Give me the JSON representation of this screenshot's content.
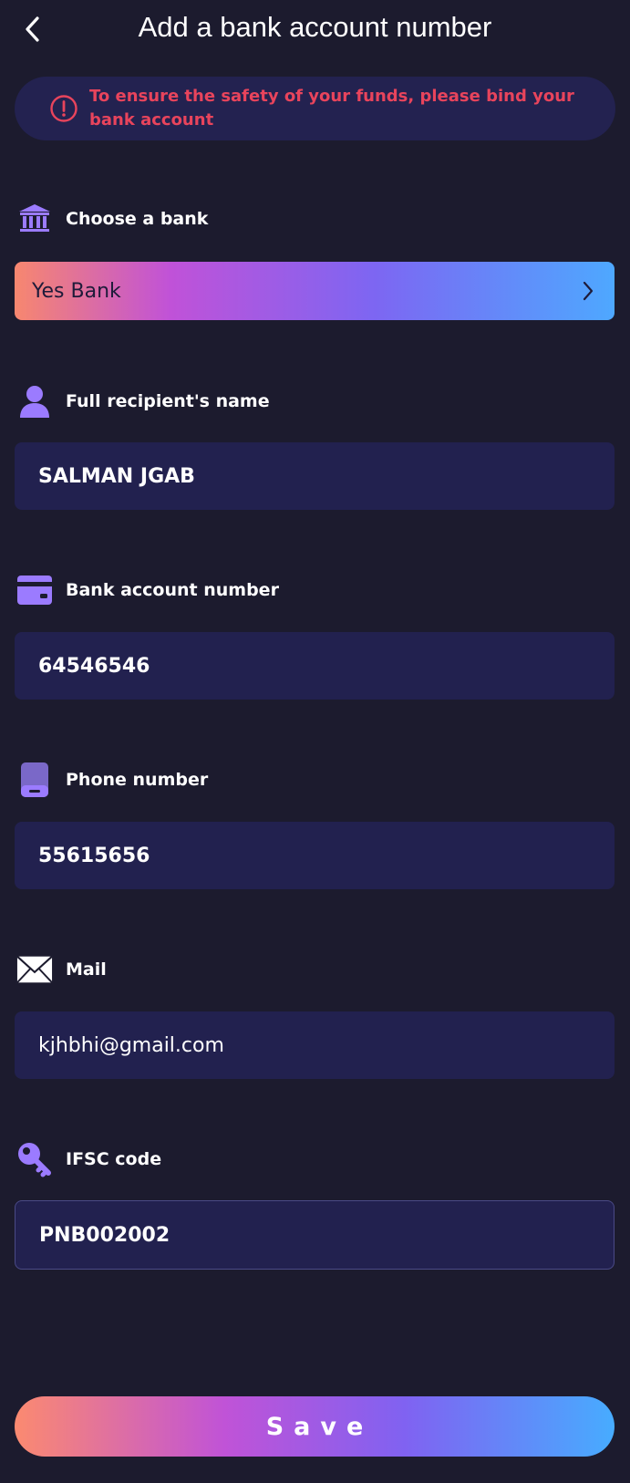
{
  "header": {
    "title": "Add a bank account number"
  },
  "notice": {
    "text": "To ensure the safety of your funds, please bind your bank account"
  },
  "bank": {
    "label": "Choose a bank",
    "value": "Yes Bank"
  },
  "recipient": {
    "label": "Full recipient's name",
    "value": "SALMAN JGAB"
  },
  "account": {
    "label": "Bank account number",
    "value": "64546546"
  },
  "phone": {
    "label": "Phone number",
    "value": "55615656"
  },
  "mail": {
    "label": "Mail",
    "value": "kjhbhi@gmail.com"
  },
  "ifsc": {
    "label": "IFSC code",
    "value": "PNB002002"
  },
  "save": {
    "label": "Save"
  },
  "colors": {
    "background": "#1c1b2e",
    "field": "#22214f",
    "accent_icon": "#9b7bff",
    "warning": "#e8445c",
    "gradient_start": "#f7876f",
    "gradient_mid": "#c052d8",
    "gradient_end": "#4ea8ff"
  },
  "icons": [
    "back-icon",
    "warning-icon",
    "bank-icon",
    "person-icon",
    "card-icon",
    "phone-icon",
    "mail-icon",
    "key-icon",
    "chevron-right-icon"
  ]
}
